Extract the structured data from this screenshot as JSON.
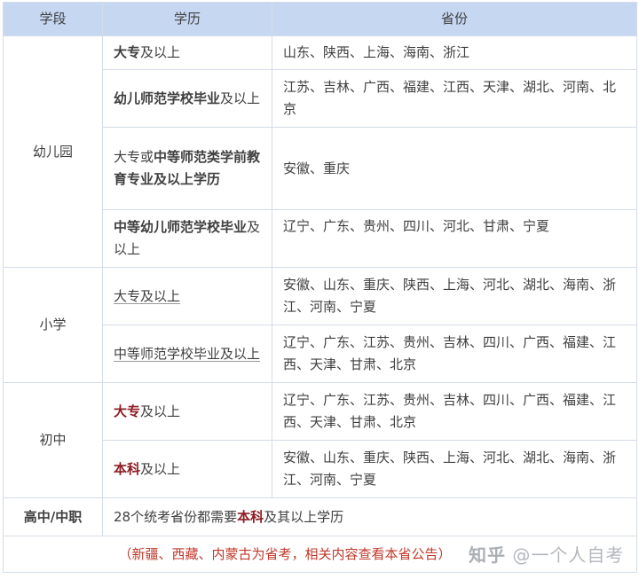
{
  "header": {
    "stage": "学段",
    "education": "学历",
    "province": "省份"
  },
  "kindergarten": {
    "stage": "幼儿园",
    "rows": [
      {
        "edu_bold": "大专",
        "edu_rest": "及以上",
        "provinces": "山东、陕西、上海、海南、浙江"
      },
      {
        "edu_bold": "幼儿师范学校毕业",
        "edu_rest": "及以上",
        "provinces": "江苏、吉林、广西、福建、江西、天津、湖北、河南、北京"
      },
      {
        "edu_plain": "大专或",
        "edu_bold": "中等师范类学前教育专业及以上学历",
        "provinces": "安徽、重庆"
      },
      {
        "edu_bold": "中等幼儿师范学校毕业",
        "edu_rest": "及以上",
        "provinces": "辽宁、广东、贵州、四川、河北、甘肃、宁夏"
      }
    ]
  },
  "primary": {
    "stage": "小学",
    "rows": [
      {
        "edu": "大专及以上",
        "provinces": "安徽、山东、重庆、陕西、上海、河北、湖北、海南、浙江、河南、宁夏"
      },
      {
        "edu": "中等师范学校毕业及以上",
        "provinces": "辽宁、广东、江苏、贵州、吉林、四川、广西、福建、江西、天津、甘肃、北京"
      }
    ]
  },
  "junior": {
    "stage": "初中",
    "rows": [
      {
        "edu_red": "大专",
        "edu_rest": "及以上",
        "provinces": "辽宁、广东、江苏、贵州、吉林、四川、广西、福建、江西、天津、甘肃、北京"
      },
      {
        "edu_red": "本科",
        "edu_rest": "及以上",
        "provinces": "安徽、山东、重庆、陕西、上海、河北、湖北、海南、浙江、河南、宁夏"
      }
    ]
  },
  "high": {
    "stage": "高中/中职",
    "text_pre": "28个统考省份都需要",
    "text_red": "本科",
    "text_post": "及其以上学历"
  },
  "note": "（新疆、西藏、内蒙古为省考，相关内容查看本省公告）",
  "watermark": {
    "brand": "知乎",
    "handle": "@一个人自考"
  }
}
